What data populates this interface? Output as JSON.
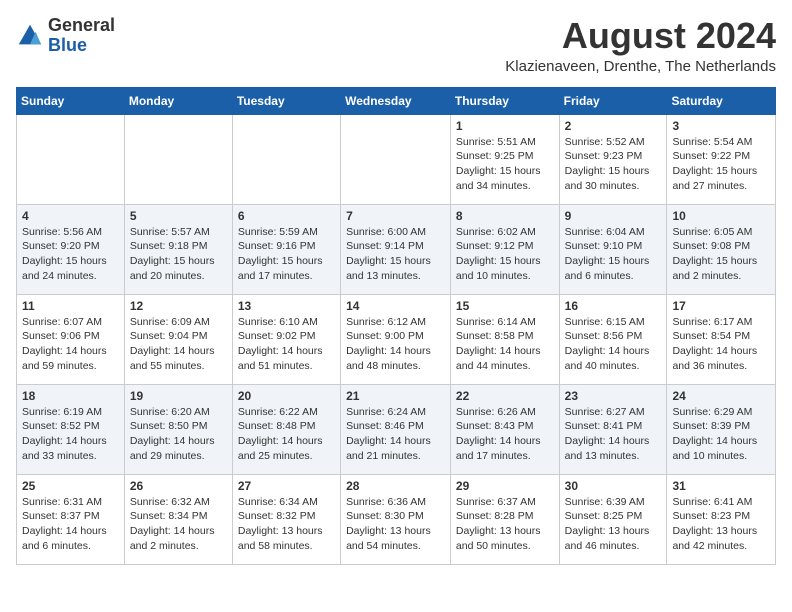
{
  "header": {
    "logo_general": "General",
    "logo_blue": "Blue",
    "month_year": "August 2024",
    "location": "Klazienaveen, Drenthe, The Netherlands"
  },
  "weekdays": [
    "Sunday",
    "Monday",
    "Tuesday",
    "Wednesday",
    "Thursday",
    "Friday",
    "Saturday"
  ],
  "weeks": [
    [
      {
        "day": "",
        "info": ""
      },
      {
        "day": "",
        "info": ""
      },
      {
        "day": "",
        "info": ""
      },
      {
        "day": "",
        "info": ""
      },
      {
        "day": "1",
        "info": "Sunrise: 5:51 AM\nSunset: 9:25 PM\nDaylight: 15 hours and 34 minutes."
      },
      {
        "day": "2",
        "info": "Sunrise: 5:52 AM\nSunset: 9:23 PM\nDaylight: 15 hours and 30 minutes."
      },
      {
        "day": "3",
        "info": "Sunrise: 5:54 AM\nSunset: 9:22 PM\nDaylight: 15 hours and 27 minutes."
      }
    ],
    [
      {
        "day": "4",
        "info": "Sunrise: 5:56 AM\nSunset: 9:20 PM\nDaylight: 15 hours and 24 minutes."
      },
      {
        "day": "5",
        "info": "Sunrise: 5:57 AM\nSunset: 9:18 PM\nDaylight: 15 hours and 20 minutes."
      },
      {
        "day": "6",
        "info": "Sunrise: 5:59 AM\nSunset: 9:16 PM\nDaylight: 15 hours and 17 minutes."
      },
      {
        "day": "7",
        "info": "Sunrise: 6:00 AM\nSunset: 9:14 PM\nDaylight: 15 hours and 13 minutes."
      },
      {
        "day": "8",
        "info": "Sunrise: 6:02 AM\nSunset: 9:12 PM\nDaylight: 15 hours and 10 minutes."
      },
      {
        "day": "9",
        "info": "Sunrise: 6:04 AM\nSunset: 9:10 PM\nDaylight: 15 hours and 6 minutes."
      },
      {
        "day": "10",
        "info": "Sunrise: 6:05 AM\nSunset: 9:08 PM\nDaylight: 15 hours and 2 minutes."
      }
    ],
    [
      {
        "day": "11",
        "info": "Sunrise: 6:07 AM\nSunset: 9:06 PM\nDaylight: 14 hours and 59 minutes."
      },
      {
        "day": "12",
        "info": "Sunrise: 6:09 AM\nSunset: 9:04 PM\nDaylight: 14 hours and 55 minutes."
      },
      {
        "day": "13",
        "info": "Sunrise: 6:10 AM\nSunset: 9:02 PM\nDaylight: 14 hours and 51 minutes."
      },
      {
        "day": "14",
        "info": "Sunrise: 6:12 AM\nSunset: 9:00 PM\nDaylight: 14 hours and 48 minutes."
      },
      {
        "day": "15",
        "info": "Sunrise: 6:14 AM\nSunset: 8:58 PM\nDaylight: 14 hours and 44 minutes."
      },
      {
        "day": "16",
        "info": "Sunrise: 6:15 AM\nSunset: 8:56 PM\nDaylight: 14 hours and 40 minutes."
      },
      {
        "day": "17",
        "info": "Sunrise: 6:17 AM\nSunset: 8:54 PM\nDaylight: 14 hours and 36 minutes."
      }
    ],
    [
      {
        "day": "18",
        "info": "Sunrise: 6:19 AM\nSunset: 8:52 PM\nDaylight: 14 hours and 33 minutes."
      },
      {
        "day": "19",
        "info": "Sunrise: 6:20 AM\nSunset: 8:50 PM\nDaylight: 14 hours and 29 minutes."
      },
      {
        "day": "20",
        "info": "Sunrise: 6:22 AM\nSunset: 8:48 PM\nDaylight: 14 hours and 25 minutes."
      },
      {
        "day": "21",
        "info": "Sunrise: 6:24 AM\nSunset: 8:46 PM\nDaylight: 14 hours and 21 minutes."
      },
      {
        "day": "22",
        "info": "Sunrise: 6:26 AM\nSunset: 8:43 PM\nDaylight: 14 hours and 17 minutes."
      },
      {
        "day": "23",
        "info": "Sunrise: 6:27 AM\nSunset: 8:41 PM\nDaylight: 14 hours and 13 minutes."
      },
      {
        "day": "24",
        "info": "Sunrise: 6:29 AM\nSunset: 8:39 PM\nDaylight: 14 hours and 10 minutes."
      }
    ],
    [
      {
        "day": "25",
        "info": "Sunrise: 6:31 AM\nSunset: 8:37 PM\nDaylight: 14 hours and 6 minutes."
      },
      {
        "day": "26",
        "info": "Sunrise: 6:32 AM\nSunset: 8:34 PM\nDaylight: 14 hours and 2 minutes."
      },
      {
        "day": "27",
        "info": "Sunrise: 6:34 AM\nSunset: 8:32 PM\nDaylight: 13 hours and 58 minutes."
      },
      {
        "day": "28",
        "info": "Sunrise: 6:36 AM\nSunset: 8:30 PM\nDaylight: 13 hours and 54 minutes."
      },
      {
        "day": "29",
        "info": "Sunrise: 6:37 AM\nSunset: 8:28 PM\nDaylight: 13 hours and 50 minutes."
      },
      {
        "day": "30",
        "info": "Sunrise: 6:39 AM\nSunset: 8:25 PM\nDaylight: 13 hours and 46 minutes."
      },
      {
        "day": "31",
        "info": "Sunrise: 6:41 AM\nSunset: 8:23 PM\nDaylight: 13 hours and 42 minutes."
      }
    ]
  ]
}
